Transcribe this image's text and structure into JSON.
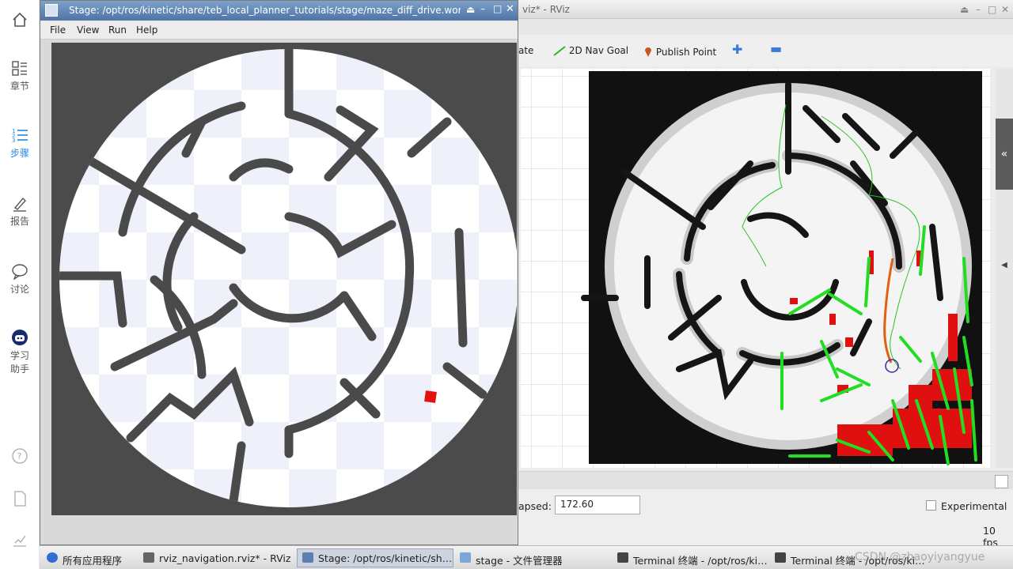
{
  "left_sidebar": {
    "home_label": "",
    "chapters_label": "章节",
    "steps_label": "步骤",
    "report_label": "报告",
    "discussion_label": "讨论",
    "assistant_label_1": "学习",
    "assistant_label_2": "助手"
  },
  "stage_window": {
    "title": "Stage: /opt/ros/kinetic/share/teb_local_planner_tutorials/stage/maze_diff_drive.world",
    "menu": [
      "File",
      "View",
      "Run",
      "Help"
    ]
  },
  "rviz_window": {
    "title": "rviz_navigation.rviz* - RViz",
    "tools": {
      "estimate_partial": "ate",
      "nav_goal": "2D Nav Goal",
      "publish_point": "Publish Point"
    },
    "time_panel": {
      "elapsed_label": "apsed:",
      "elapsed_value": "172.60",
      "experimental_label": "Experimental",
      "fps": "10 fps"
    }
  },
  "taskbar": {
    "apps_label": "所有应用程序",
    "tasks": [
      "rviz_navigation.rviz* - RViz",
      "Stage: /opt/ros/kinetic/sh…",
      "stage - 文件管理器",
      "Terminal 终端 - /opt/ros/ki…",
      "Terminal 终端 - /opt/ros/ki…"
    ],
    "watermark": "CSDN @zhaoyiyangyue"
  },
  "colors": {
    "stage_title": "#5a7fb0",
    "nav_goal_green": "#2bb52b",
    "obstacle_red": "#e01010",
    "local_costmap_green": "#22dd22"
  }
}
